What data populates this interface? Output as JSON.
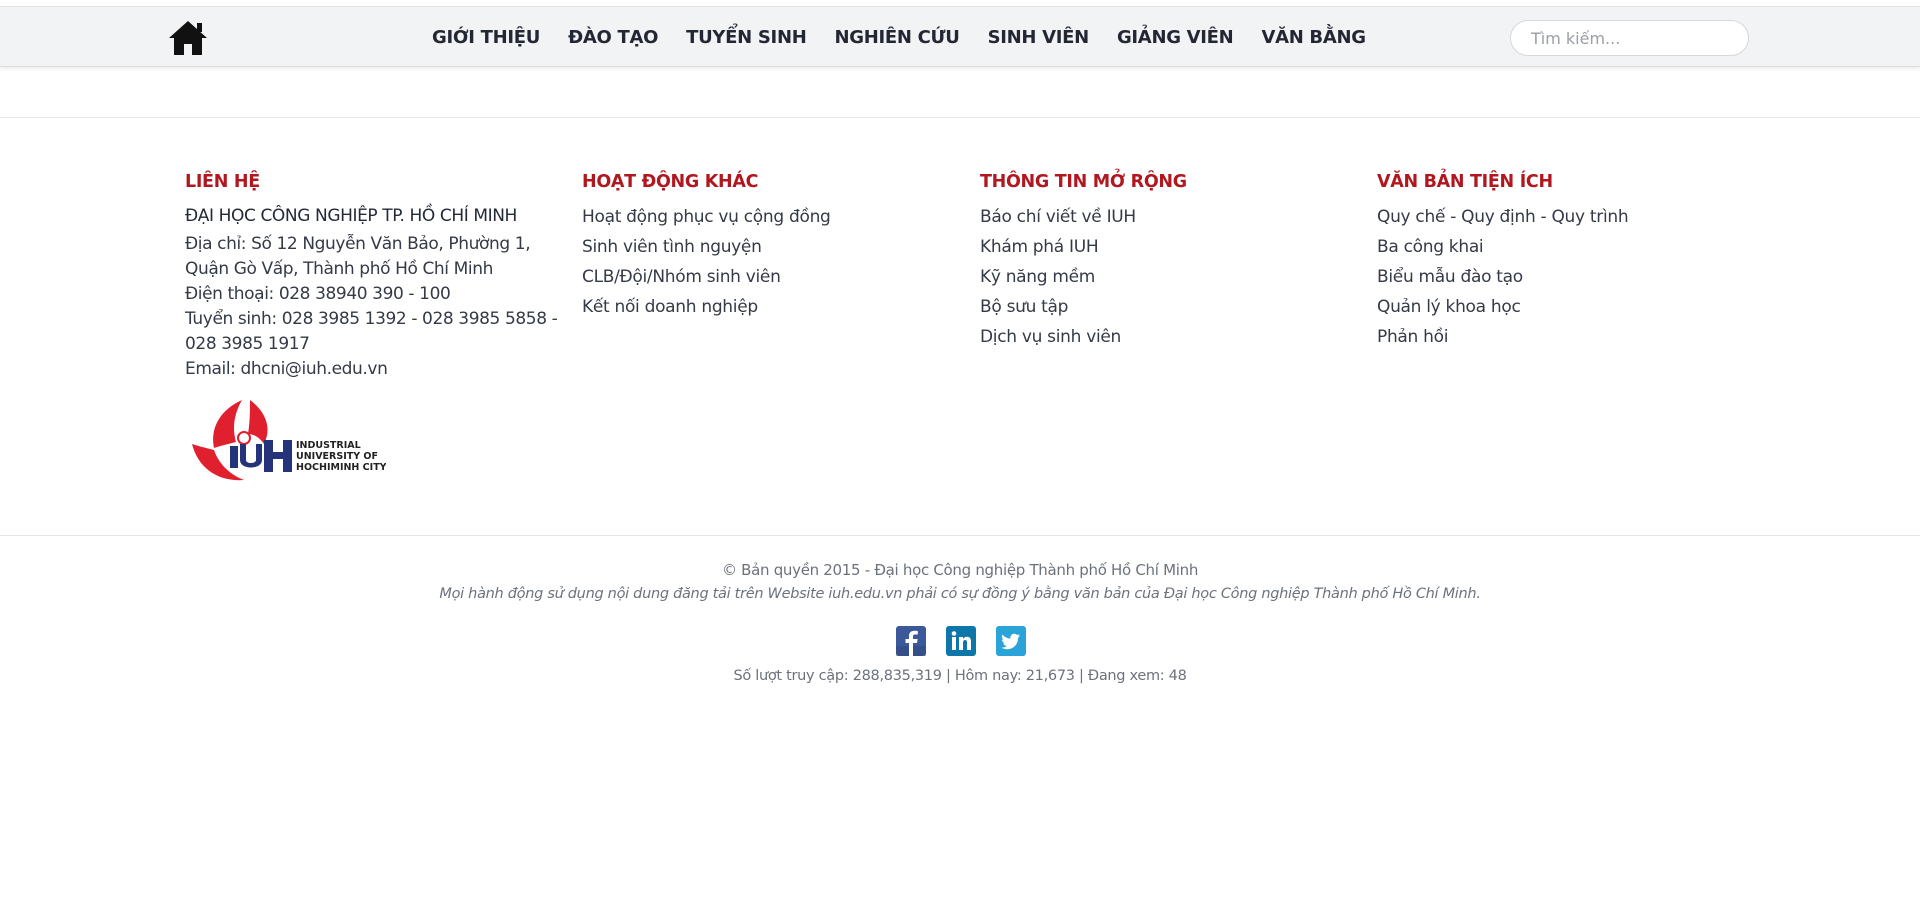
{
  "nav": {
    "home_icon": "home-icon",
    "items": [
      {
        "label": "GIỚI THIỆU"
      },
      {
        "label": "ĐÀO TẠO"
      },
      {
        "label": "TUYỂN SINH"
      },
      {
        "label": "NGHIÊN CỨU"
      },
      {
        "label": "SINH VIÊN"
      },
      {
        "label": "GIẢNG VIÊN"
      },
      {
        "label": "VĂN BẰNG"
      }
    ],
    "search_placeholder": "Tìm kiếm..."
  },
  "footer": {
    "contact": {
      "title": "LIÊN HỆ",
      "org_name": "ĐẠI HỌC CÔNG NGHIỆP TP. HỒ CHÍ MINH",
      "address_line1": "Địa chỉ: Số 12 Nguyễn Văn Bảo, Phường 1,",
      "address_line2": "Quận Gò Vấp, Thành phố Hồ Chí Minh",
      "phone": "Điện thoại: 028 38940 390 - 100",
      "admission_line1": "Tuyển sinh: 028 3985 1392 - 028 3985 5858 -",
      "admission_line2": "028 3985 1917",
      "email": "Email: dhcni@iuh.edu.vn"
    },
    "logo": {
      "text_line1": "INDUSTRIAL",
      "text_line2": "UNIVERSITY OF",
      "text_line3": "HOCHIMINH CITY",
      "letters": "IUH",
      "colors": {
        "red": "#e0202e",
        "navy": "#25337a"
      }
    },
    "other_activities": {
      "title": "HOẠT ĐỘNG KHÁC",
      "links": [
        {
          "label": "Hoạt động phục vụ cộng đồng"
        },
        {
          "label": "Sinh viên tình nguyện"
        },
        {
          "label": "CLB/Đội/Nhóm sinh viên"
        },
        {
          "label": "Kết nối doanh nghiệp"
        }
      ]
    },
    "extended_info": {
      "title": "THÔNG TIN MỞ RỘNG",
      "links": [
        {
          "label": "Báo chí viết về IUH"
        },
        {
          "label": "Khám phá IUH"
        },
        {
          "label": "Kỹ năng mềm"
        },
        {
          "label": "Bộ sưu tập"
        },
        {
          "label": "Dịch vụ sinh viên"
        }
      ]
    },
    "documents": {
      "title": "VĂN BẢN TIỆN ÍCH",
      "links": [
        {
          "label": "Quy chế - Quy định - Quy trình"
        },
        {
          "label": "Ba công khai"
        },
        {
          "label": "Biểu mẫu đào tạo"
        },
        {
          "label": "Quản lý khoa học"
        },
        {
          "label": "Phản hồi"
        }
      ]
    }
  },
  "bottom": {
    "copyright": "© Bản quyền 2015 - Đại học Công nghiệp Thành phố Hồ Chí Minh",
    "notice": "Mọi hành động sử dụng nội dung đăng tải trên Website iuh.edu.vn phải có sự đồng ý bằng văn bản của Đại học Công nghiệp Thành phố Hồ Chí Minh.",
    "social": [
      {
        "icon": "facebook-icon",
        "letter": "f",
        "color": "#3b5998"
      },
      {
        "icon": "linkedin-icon",
        "letter": "in",
        "color": "#0e76a8"
      },
      {
        "icon": "twitter-icon",
        "letter": "t",
        "color": "#2aa3d8"
      }
    ],
    "stats": "Số lượt truy cập: 288,835,319 | Hôm nay: 21,673 | Đang xem: 48"
  },
  "colors": {
    "accent_red": "#b0171f",
    "nav_bg": "#f2f3f4",
    "text_dark": "#232a37",
    "text_muted": "#6c727c"
  }
}
